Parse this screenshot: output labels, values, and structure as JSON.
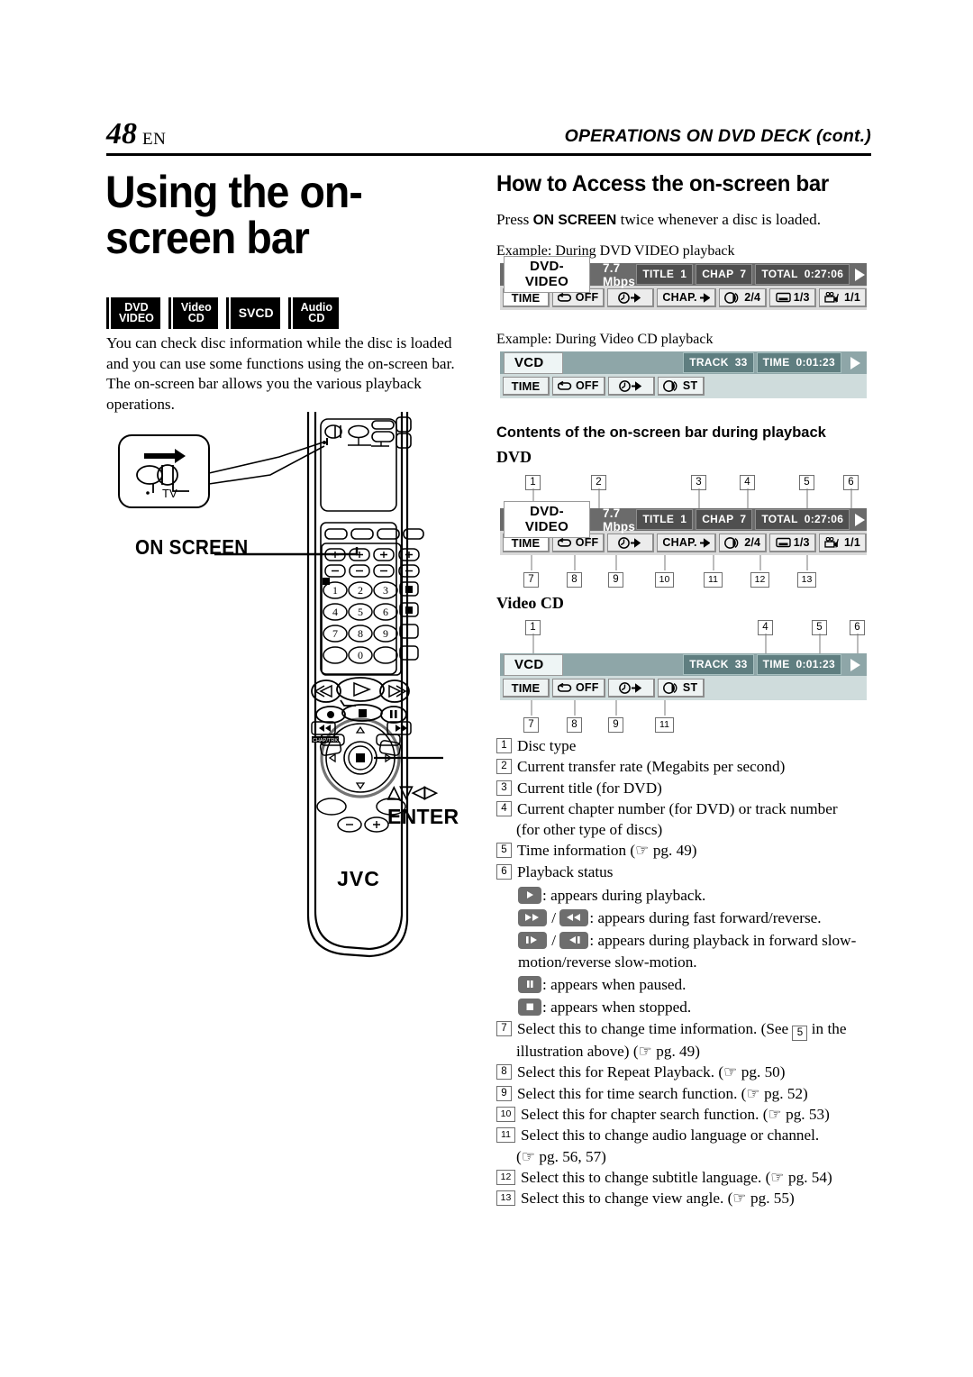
{
  "header": {
    "page_number": "48",
    "page_lang": "EN",
    "running_head": "OPERATIONS ON DVD DECK (cont.)"
  },
  "left": {
    "title": "Using the on-screen bar",
    "badges": [
      {
        "name": "badge-dvd-video",
        "line1": "DVD",
        "line2": "VIDEO"
      },
      {
        "name": "badge-video-cd",
        "line1": "Video",
        "line2": "CD"
      },
      {
        "name": "badge-svcd",
        "line1": "SVCD",
        "line2": ""
      },
      {
        "name": "badge-audio-cd",
        "line1": "Audio",
        "line2": "CD"
      }
    ],
    "lead": "You can check disc information while the disc is loaded and you can use some functions using the on-screen bar. The on-screen bar allows you the various playback operations.",
    "remote": {
      "on_screen_label": "ON SCREEN",
      "enter_label": "ENTER",
      "enter_arrows": "△▽◁▷",
      "tv_callout_label": "TV",
      "brand": "JVC",
      "keypad": [
        "1",
        "2",
        "3",
        "4",
        "5",
        "6",
        "7",
        "8",
        "9",
        "0"
      ]
    }
  },
  "right": {
    "heading": "How to Access the on-screen bar",
    "intro_before": "Press ",
    "intro_bold": "ON SCREEN",
    "intro_after": " twice whenever a disc is loaded.",
    "example_dvd_caption": "Example: During DVD VIDEO playback",
    "example_vcd_caption": "Example: During Video CD playback",
    "contents_heading": "Contents of the on-screen bar during playback",
    "dvd_heading": "DVD",
    "videocd_heading": "Video CD"
  },
  "osd_dvd": {
    "disc_type": "DVD-VIDEO",
    "rate": "7.7 Mbps",
    "info_chips": [
      {
        "name": "title-chip",
        "label": "TITLE",
        "value": "1"
      },
      {
        "name": "chapter-chip",
        "label": "CHAP",
        "value": "7"
      },
      {
        "name": "total-time-chip",
        "label": "TOTAL",
        "value": "0:27:06"
      }
    ],
    "playback_status": "play",
    "buttons": [
      {
        "name": "time-button",
        "label": "TIME",
        "icon": ""
      },
      {
        "name": "repeat-button",
        "label": "OFF",
        "icon": "repeat-icon"
      },
      {
        "name": "time-search-button",
        "label": "",
        "icon": "clock-arrow-icon"
      },
      {
        "name": "chapter-search-button",
        "label": "CHAP.",
        "icon": "arrow-right-icon"
      },
      {
        "name": "audio-button",
        "label": "2/4",
        "icon": "audio-circles-icon"
      },
      {
        "name": "subtitle-button",
        "label": "1/3",
        "icon": "subtitle-icon"
      },
      {
        "name": "angle-button",
        "label": "1/1",
        "icon": "camera-angle-icon"
      }
    ]
  },
  "osd_vcd": {
    "disc_type": "VCD",
    "info_chips": [
      {
        "name": "track-chip",
        "label": "TRACK",
        "value": "33"
      },
      {
        "name": "time-chip",
        "label": "TIME",
        "value": "0:01:23"
      }
    ],
    "playback_status": "play",
    "buttons": [
      {
        "name": "time-button",
        "label": "TIME",
        "icon": ""
      },
      {
        "name": "repeat-button",
        "label": "OFF",
        "icon": "repeat-icon"
      },
      {
        "name": "time-search-button",
        "label": "",
        "icon": "clock-arrow-icon"
      },
      {
        "name": "audio-button",
        "label": "ST",
        "icon": "audio-circles-icon"
      }
    ]
  },
  "callouts": {
    "dvd_top": [
      "1",
      "2",
      "3",
      "4",
      "5",
      "6"
    ],
    "dvd_bottom": [
      "7",
      "8",
      "9",
      "10",
      "11",
      "12",
      "13"
    ],
    "vcd_top": [
      "1",
      "4",
      "5",
      "6"
    ],
    "vcd_bottom": [
      "7",
      "8",
      "9",
      "11"
    ]
  },
  "legend": [
    {
      "num": "1",
      "text": "Disc type"
    },
    {
      "num": "2",
      "text": "Current transfer rate (Megabits per second)"
    },
    {
      "num": "3",
      "text": "Current title (for DVD)"
    },
    {
      "num": "4",
      "text": "Current chapter number (for DVD) or track number",
      "sub": "(for other type of discs)"
    },
    {
      "num": "5",
      "text": "Time information (☞ pg. 49)"
    },
    {
      "num": "6",
      "text": "Playback status"
    }
  ],
  "status_items": [
    {
      "name": "status-play",
      "icons": [
        "play"
      ],
      "text": ": appears during playback."
    },
    {
      "name": "status-fast",
      "icons": [
        "ff",
        "rew"
      ],
      "text": ": appears during fast forward/reverse."
    },
    {
      "name": "status-slow",
      "icons": [
        "slow-fwd",
        "slow-rev"
      ],
      "text": ": appears during playback in forward slow-"
    },
    {
      "name": "status-slow-cont",
      "icons": [],
      "text": "motion/reverse slow-motion."
    },
    {
      "name": "status-pause",
      "icons": [
        "pause"
      ],
      "text": ": appears when paused."
    },
    {
      "name": "status-stop",
      "icons": [
        "stop"
      ],
      "text": ": appears when stopped."
    }
  ],
  "legend2": [
    {
      "num": "7",
      "text": "Select this to change time information. (See ",
      "inline_num": "5",
      "text2": " in the",
      "sub": "illustration above) (☞ pg. 49)"
    },
    {
      "num": "8",
      "text": "Select this for Repeat Playback. (☞ pg. 50)"
    },
    {
      "num": "9",
      "text": "Select this for time search function. (☞ pg. 52)"
    },
    {
      "num": "10",
      "text": "Select this for chapter search function. (☞ pg. 53)"
    },
    {
      "num": "11",
      "text": "Select this to change audio language or channel.",
      "sub": "(☞ pg. 56, 57)"
    },
    {
      "num": "12",
      "text": "Select this to change subtitle language. (☞ pg. 54)"
    },
    {
      "num": "13",
      "text": "Select this to change view angle. (☞ pg. 55)"
    }
  ]
}
